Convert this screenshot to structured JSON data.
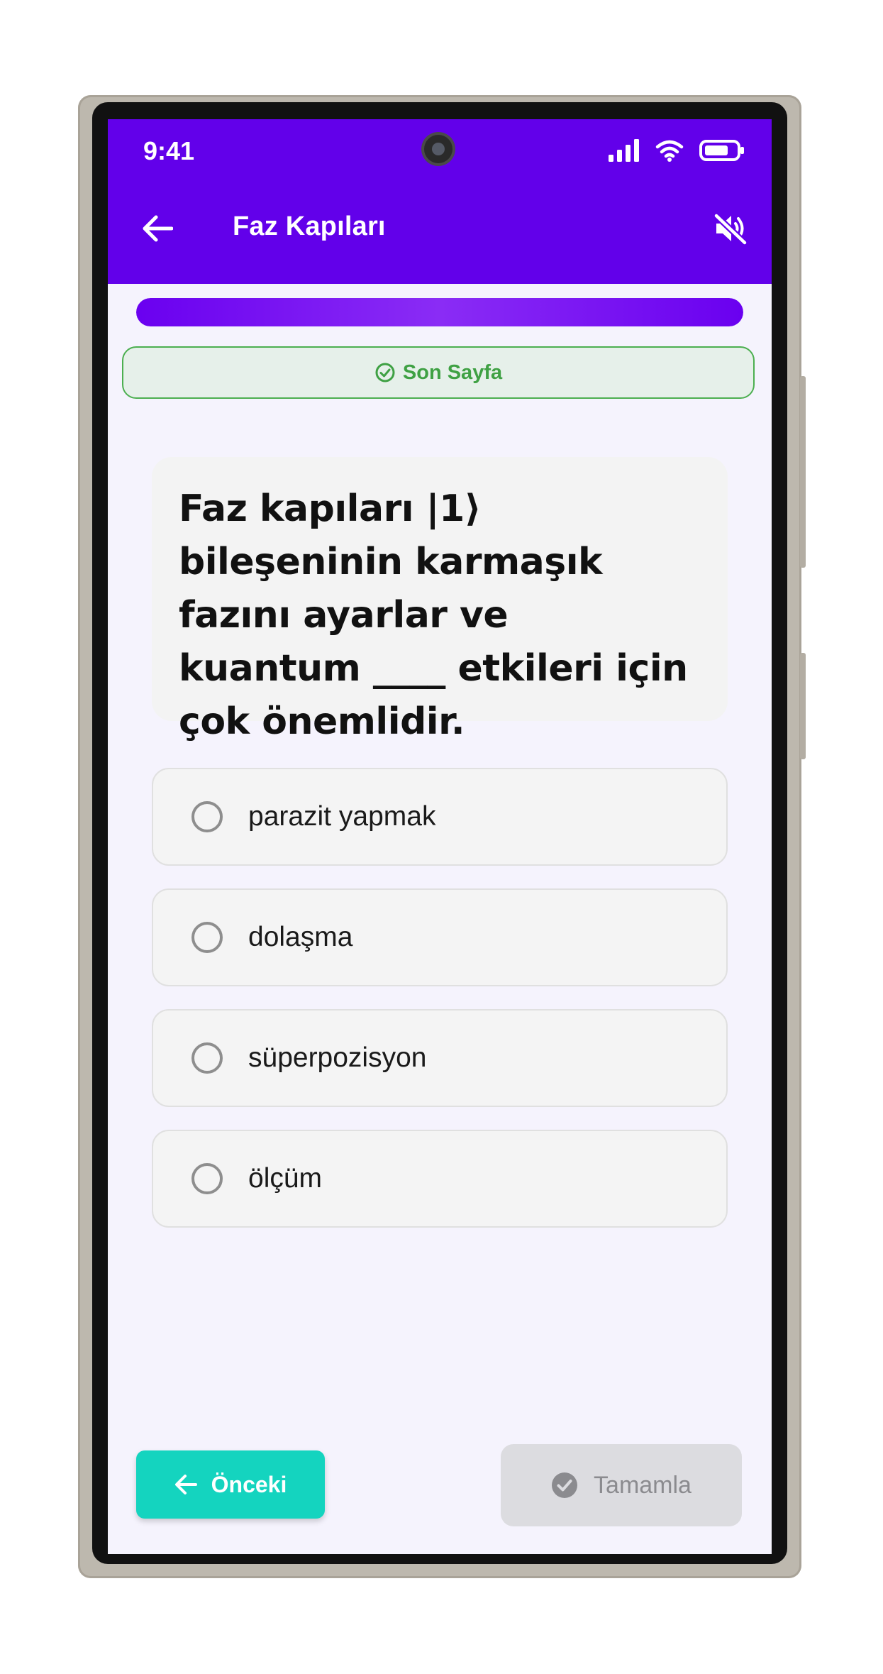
{
  "status_bar": {
    "time": "9:41"
  },
  "app_bar": {
    "title": "Faz Kapıları",
    "back_icon": "arrow-left-icon",
    "mute_icon": "volume-off-icon",
    "background": "#6200ea"
  },
  "progress": {
    "fraction": 1.0
  },
  "banner": {
    "text": "Son Sayfa",
    "icon": "check-circle-icon",
    "color": "#4caf50"
  },
  "question": {
    "text": "Faz kapıları |1⟩ bileşeninin karmaşık fazını ayarlar ve kuantum ____ etkileri için çok önemlidir."
  },
  "options": [
    {
      "label": "parazit yapmak"
    },
    {
      "label": "dolaşma"
    },
    {
      "label": "süperpozisyon"
    },
    {
      "label": "ölçüm"
    }
  ],
  "buttons": {
    "prev_label": "Önceki",
    "prev_color": "#14d4bf",
    "finish_label": "Tamamla",
    "finish_icon": "check-circle-filled-icon"
  }
}
